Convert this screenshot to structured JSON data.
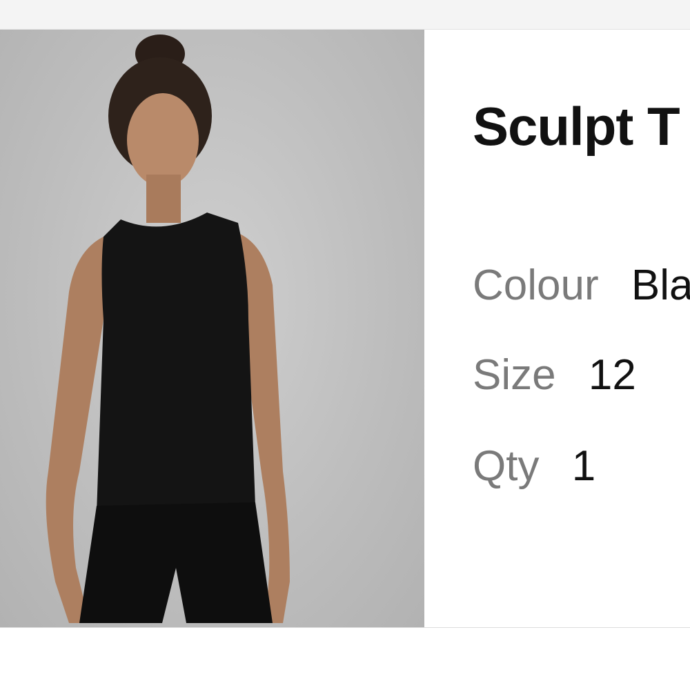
{
  "product": {
    "title": "Sculpt T",
    "image_alt": "Woman wearing black sleeveless tank top and black shorts",
    "colour_label": "Colour",
    "colour_value": "Bla",
    "size_label": "Size",
    "size_value": "12",
    "qty_label": "Qty",
    "qty_value": "1"
  },
  "colors": {
    "photo_background": "#c4c4c4",
    "garment": "#141414",
    "label_text": "#7a7a7a",
    "value_text": "#111111"
  }
}
